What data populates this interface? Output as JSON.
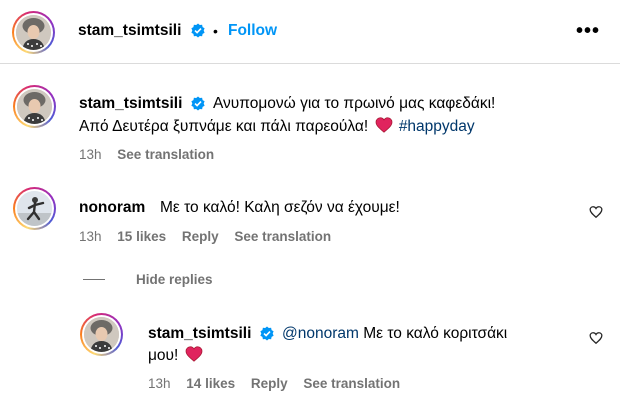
{
  "header": {
    "username": "stam_tsimtsili",
    "separator": "•",
    "follow_label": "Follow",
    "more_label": "•••"
  },
  "caption": {
    "username": "stam_tsimtsili",
    "line1": "Ανυπομονώ για το πρωινό μας καφεδάκι!",
    "line2": "Από Δευτέρα ξυπνάμε και πάλι παρεούλα!",
    "hashtag": "#happyday",
    "time": "13h",
    "see_translation": "See translation"
  },
  "comments": [
    {
      "username": "nonoram",
      "text": "Με το καλό! Καλη σεζόν να έχουμε!",
      "time": "13h",
      "likes": "15 likes",
      "reply": "Reply",
      "see_translation": "See translation"
    }
  ],
  "hide_replies": "Hide replies",
  "replies": [
    {
      "username": "stam_tsimtsili",
      "mention": "@nonoram",
      "text1": "Με το καλό κοριτσάκι",
      "text2": "μου!",
      "time": "13h",
      "likes": "14 likes",
      "reply": "Reply",
      "see_translation": "See translation"
    }
  ],
  "colors": {
    "link_blue": "#0095f6",
    "muted": "#737373",
    "heart": "#e0245e"
  }
}
